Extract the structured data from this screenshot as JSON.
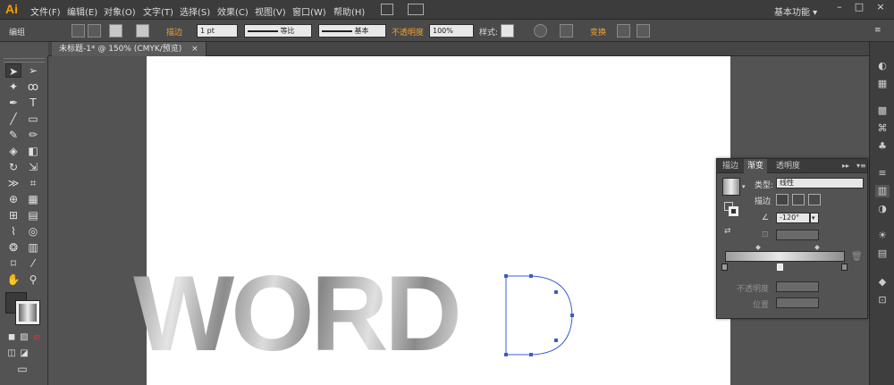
{
  "app": {
    "logo": "Ai"
  },
  "menu": [
    "文件(F)",
    "编辑(E)",
    "对象(O)",
    "文字(T)",
    "选择(S)",
    "效果(C)",
    "视图(V)",
    "窗口(W)",
    "帮助(H)"
  ],
  "workspace": {
    "label": "基本功能"
  },
  "window_controls": [
    "–",
    "□",
    "×"
  ],
  "control_bar": {
    "mode": "编组",
    "stroke_label": "描边",
    "stroke_value": "1 pt",
    "profile_label": "等比",
    "brush_label": "基本",
    "opacity_label": "不透明度",
    "opacity_value": "100%",
    "style_label": "样式:",
    "transform_label": "变换"
  },
  "document_tab": {
    "title": "未标题-1* @ 150% (CMYK/预览)",
    "close": "×"
  },
  "canvas": {
    "text": "WORD"
  },
  "gradient_panel": {
    "tabs": [
      "描边",
      "渐变",
      "透明度"
    ],
    "type_label": "类型:",
    "type_value": "线性",
    "stroke_label": "描边",
    "angle_value": "-120°",
    "opacity_label": "不透明度",
    "position_label": "位置"
  },
  "colors": {
    "accent": "#f0a030",
    "selection": "#3a5ccc",
    "ui_dark": "#3c3c3c",
    "ui_mid": "#535353"
  }
}
